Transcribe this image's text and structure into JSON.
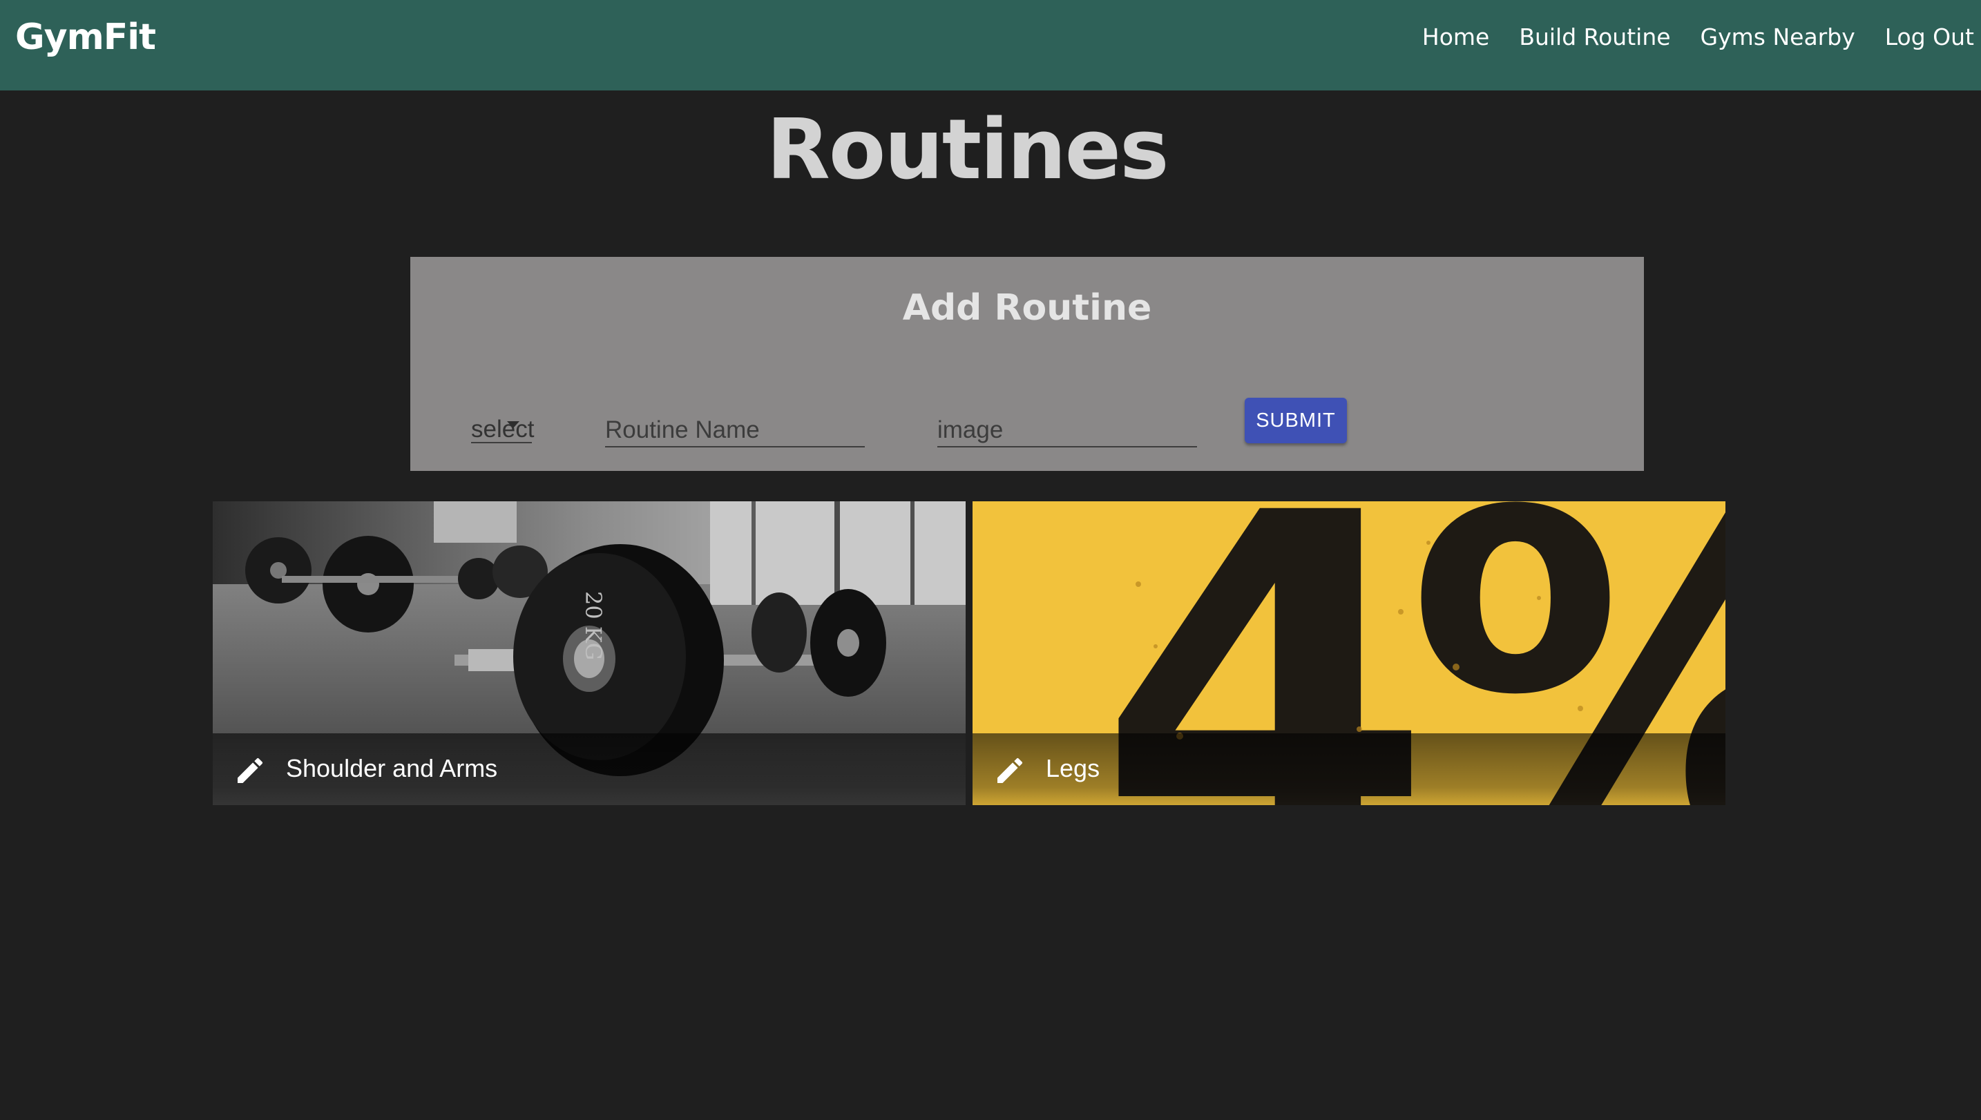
{
  "navbar": {
    "brand": "GymFit",
    "links": [
      "Home",
      "Build Routine",
      "Gyms Nearby",
      "Log Out"
    ]
  },
  "page": {
    "title": "Routines"
  },
  "add_routine": {
    "title": "Add Routine",
    "select_value": "select",
    "name_placeholder": "Routine Name",
    "image_placeholder": "image",
    "submit_label": "SUBMIT"
  },
  "routines": [
    {
      "title": "Shoulder and Arms",
      "image": "barbell-photo",
      "plate_label": "20 KG"
    },
    {
      "title": "Legs",
      "image": "yellow-poster",
      "poster_text": "4%"
    }
  ],
  "colors": {
    "navbar": "#2e6158",
    "background": "#1f1f1f",
    "panel": "#8a8888",
    "submit": "#3f51b5",
    "poster_yellow": "#f2c23c"
  }
}
